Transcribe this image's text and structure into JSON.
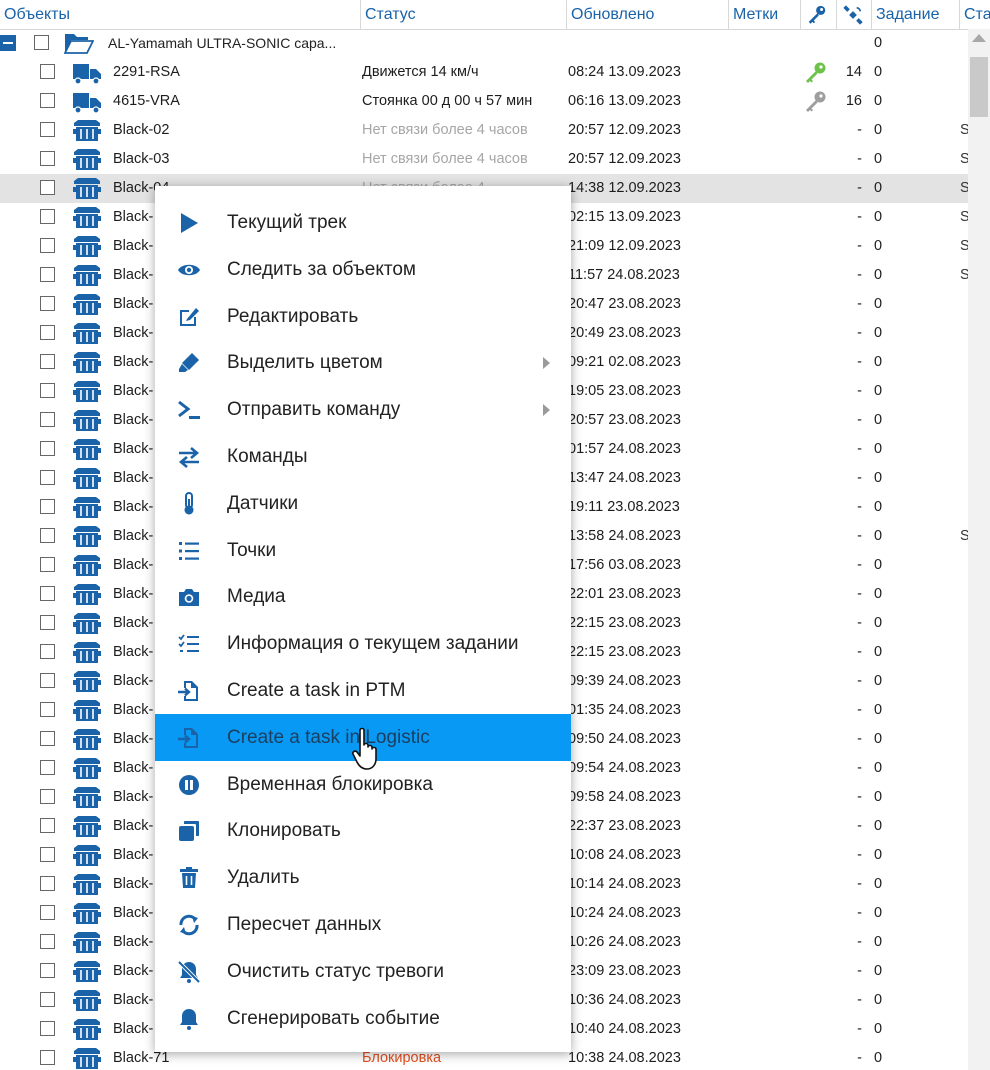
{
  "header": {
    "objects": "Объекты",
    "status": "Статус",
    "updated": "Обновлено",
    "tags": "Метки",
    "task": "Задание",
    "state": "Ста"
  },
  "group": {
    "name": "AL-Yamamah ULTRA-SONIC capa...",
    "task": "0"
  },
  "rows": [
    {
      "name": "2291-RSA",
      "status": "Движется 14 км/ч",
      "kind": "moving",
      "updated": "08:24 13.09.2023",
      "sats": "14",
      "task": "0",
      "icon": "truck-icon",
      "key": "key-green-icon",
      "extra": ""
    },
    {
      "name": "4615-VRA",
      "status": "Стоянка 00 д 00 ч 57 мин",
      "kind": "parked",
      "updated": "06:16 13.09.2023",
      "sats": "16",
      "task": "0",
      "icon": "truck-icon",
      "key": "key-grey-icon",
      "extra": ""
    },
    {
      "name": "Black-02",
      "status": "Нет связи более 4 часов",
      "kind": "nolink",
      "updated": "20:57 12.09.2023",
      "sats": "-",
      "task": "0",
      "icon": "container-icon",
      "key": "",
      "extra": "S"
    },
    {
      "name": "Black-03",
      "status": "Нет связи более 4 часов",
      "kind": "nolink",
      "updated": "20:57 12.09.2023",
      "sats": "-",
      "task": "0",
      "icon": "container-icon",
      "key": "",
      "extra": "S"
    },
    {
      "name": "Black-04",
      "status": "Нет связи более 4",
      "kind": "nolink",
      "updated": "14:38 12.09.2023",
      "sats": "-",
      "task": "0",
      "icon": "container-icon",
      "key": "",
      "extra": "S",
      "selected": true
    },
    {
      "name": "Black-",
      "status": "",
      "kind": "",
      "updated": "02:15 13.09.2023",
      "sats": "-",
      "task": "0",
      "icon": "container-icon",
      "key": "",
      "extra": "S"
    },
    {
      "name": "Black-",
      "status": "",
      "kind": "",
      "updated": "21:09 12.09.2023",
      "sats": "-",
      "task": "0",
      "icon": "container-icon",
      "key": "",
      "extra": "S"
    },
    {
      "name": "Black-",
      "status": "",
      "kind": "",
      "updated": "11:57 24.08.2023",
      "sats": "-",
      "task": "0",
      "icon": "container-icon",
      "key": "",
      "extra": "S"
    },
    {
      "name": "Black-",
      "status": "",
      "kind": "",
      "updated": "20:47 23.08.2023",
      "sats": "-",
      "task": "0",
      "icon": "container-icon",
      "key": "",
      "extra": ""
    },
    {
      "name": "Black-",
      "status": "",
      "kind": "",
      "updated": "20:49 23.08.2023",
      "sats": "-",
      "task": "0",
      "icon": "container-icon",
      "key": "",
      "extra": ""
    },
    {
      "name": "Black-",
      "status": "",
      "kind": "",
      "updated": "09:21 02.08.2023",
      "sats": "-",
      "task": "0",
      "icon": "container-icon",
      "key": "",
      "extra": ""
    },
    {
      "name": "Black-",
      "status": "",
      "kind": "",
      "updated": "19:05 23.08.2023",
      "sats": "-",
      "task": "0",
      "icon": "container-icon",
      "key": "",
      "extra": ""
    },
    {
      "name": "Black-",
      "status": "",
      "kind": "",
      "updated": "20:57 23.08.2023",
      "sats": "-",
      "task": "0",
      "icon": "container-icon",
      "key": "",
      "extra": ""
    },
    {
      "name": "Black-",
      "status": "",
      "kind": "",
      "updated": "01:57 24.08.2023",
      "sats": "-",
      "task": "0",
      "icon": "container-icon",
      "key": "",
      "extra": ""
    },
    {
      "name": "Black-",
      "status": "",
      "kind": "",
      "updated": "13:47 24.08.2023",
      "sats": "-",
      "task": "0",
      "icon": "container-icon",
      "key": "",
      "extra": ""
    },
    {
      "name": "Black-",
      "status": "",
      "kind": "",
      "updated": "19:11 23.08.2023",
      "sats": "-",
      "task": "0",
      "icon": "container-icon",
      "key": "",
      "extra": ""
    },
    {
      "name": "Black-",
      "status": "",
      "kind": "",
      "updated": "13:58 24.08.2023",
      "sats": "-",
      "task": "0",
      "icon": "container-icon",
      "key": "",
      "extra": "S"
    },
    {
      "name": "Black-",
      "status": "",
      "kind": "",
      "updated": "17:56 03.08.2023",
      "sats": "-",
      "task": "0",
      "icon": "container-icon",
      "key": "",
      "extra": ""
    },
    {
      "name": "Black-",
      "status": "",
      "kind": "",
      "updated": "22:01 23.08.2023",
      "sats": "-",
      "task": "0",
      "icon": "container-icon",
      "key": "",
      "extra": ""
    },
    {
      "name": "Black-",
      "status": "",
      "kind": "",
      "updated": "22:15 23.08.2023",
      "sats": "-",
      "task": "0",
      "icon": "container-icon",
      "key": "",
      "extra": ""
    },
    {
      "name": "Black-",
      "status": "",
      "kind": "",
      "updated": "22:15 23.08.2023",
      "sats": "-",
      "task": "0",
      "icon": "container-icon",
      "key": "",
      "extra": ""
    },
    {
      "name": "Black-",
      "status": "",
      "kind": "",
      "updated": "09:39 24.08.2023",
      "sats": "-",
      "task": "0",
      "icon": "container-icon",
      "key": "",
      "extra": ""
    },
    {
      "name": "Black-",
      "status": "",
      "kind": "",
      "updated": "01:35 24.08.2023",
      "sats": "-",
      "task": "0",
      "icon": "container-icon",
      "key": "",
      "extra": ""
    },
    {
      "name": "Black-",
      "status": "",
      "kind": "",
      "updated": "09:50 24.08.2023",
      "sats": "-",
      "task": "0",
      "icon": "container-icon",
      "key": "",
      "extra": ""
    },
    {
      "name": "Black-",
      "status": "",
      "kind": "",
      "updated": "09:54 24.08.2023",
      "sats": "-",
      "task": "0",
      "icon": "container-icon",
      "key": "",
      "extra": ""
    },
    {
      "name": "Black-",
      "status": "",
      "kind": "",
      "updated": "09:58 24.08.2023",
      "sats": "-",
      "task": "0",
      "icon": "container-icon",
      "key": "",
      "extra": ""
    },
    {
      "name": "Black-",
      "status": "",
      "kind": "",
      "updated": "22:37 23.08.2023",
      "sats": "-",
      "task": "0",
      "icon": "container-icon",
      "key": "",
      "extra": ""
    },
    {
      "name": "Black-",
      "status": "",
      "kind": "",
      "updated": "10:08 24.08.2023",
      "sats": "-",
      "task": "0",
      "icon": "container-icon",
      "key": "",
      "extra": ""
    },
    {
      "name": "Black-",
      "status": "",
      "kind": "",
      "updated": "10:14 24.08.2023",
      "sats": "-",
      "task": "0",
      "icon": "container-icon",
      "key": "",
      "extra": ""
    },
    {
      "name": "Black-",
      "status": "",
      "kind": "",
      "updated": "10:24 24.08.2023",
      "sats": "-",
      "task": "0",
      "icon": "container-icon",
      "key": "",
      "extra": ""
    },
    {
      "name": "Black-",
      "status": "",
      "kind": "",
      "updated": "10:26 24.08.2023",
      "sats": "-",
      "task": "0",
      "icon": "container-icon",
      "key": "",
      "extra": ""
    },
    {
      "name": "Black-",
      "status": "",
      "kind": "",
      "updated": "23:09 23.08.2023",
      "sats": "-",
      "task": "0",
      "icon": "container-icon",
      "key": "",
      "extra": ""
    },
    {
      "name": "Black-",
      "status": "",
      "kind": "",
      "updated": "10:36 24.08.2023",
      "sats": "-",
      "task": "0",
      "icon": "container-icon",
      "key": "",
      "extra": ""
    },
    {
      "name": "Black-",
      "status": "",
      "kind": "",
      "updated": "10:40 24.08.2023",
      "sats": "-",
      "task": "0",
      "icon": "container-icon",
      "key": "",
      "extra": ""
    },
    {
      "name": "Black-71",
      "status": "Блокировка",
      "kind": "block",
      "updated": "10:38 24.08.2023",
      "sats": "-",
      "task": "0",
      "icon": "container-icon",
      "key": "",
      "extra": ""
    }
  ],
  "context_menu": [
    {
      "label": "Текущий трек",
      "icon": "play-icon",
      "submenu": false
    },
    {
      "label": "Следить за объектом",
      "icon": "eye-icon",
      "submenu": false
    },
    {
      "label": "Редактировать",
      "icon": "edit-icon",
      "submenu": false
    },
    {
      "label": "Выделить цветом",
      "icon": "marker-icon",
      "submenu": true
    },
    {
      "label": "Отправить команду",
      "icon": "terminal-icon",
      "submenu": true
    },
    {
      "label": "Команды",
      "icon": "swap-arrows-icon",
      "submenu": false
    },
    {
      "label": "Датчики",
      "icon": "thermometer-icon",
      "submenu": false
    },
    {
      "label": "Точки",
      "icon": "list-icon",
      "submenu": false
    },
    {
      "label": "Медиа",
      "icon": "camera-icon",
      "submenu": false
    },
    {
      "label": "Информация о текущем задании",
      "icon": "checklist-icon",
      "submenu": false
    },
    {
      "label": "Create a task in PTM",
      "icon": "file-import-icon",
      "submenu": false
    },
    {
      "label": "Create a task in Logistic",
      "icon": "file-import-icon",
      "submenu": false,
      "highlighted": true
    },
    {
      "label": "Временная блокировка",
      "icon": "pause-icon",
      "submenu": false
    },
    {
      "label": "Клонировать",
      "icon": "clone-icon",
      "submenu": false
    },
    {
      "label": "Удалить",
      "icon": "trash-icon",
      "submenu": false
    },
    {
      "label": "Пересчет данных",
      "icon": "refresh-icon",
      "submenu": false
    },
    {
      "label": "Очистить статус тревоги",
      "icon": "bell-off-icon",
      "submenu": false
    },
    {
      "label": "Сгенерировать событие",
      "icon": "bell-icon",
      "submenu": false
    }
  ],
  "colors": {
    "accent_blue": "#1a63a8",
    "menu_highlight": "#0899f4",
    "status_nolink": "#a6a6a6",
    "status_block": "#e2501f",
    "key_green": "#6cc24a",
    "key_grey": "#9e9e9e"
  }
}
